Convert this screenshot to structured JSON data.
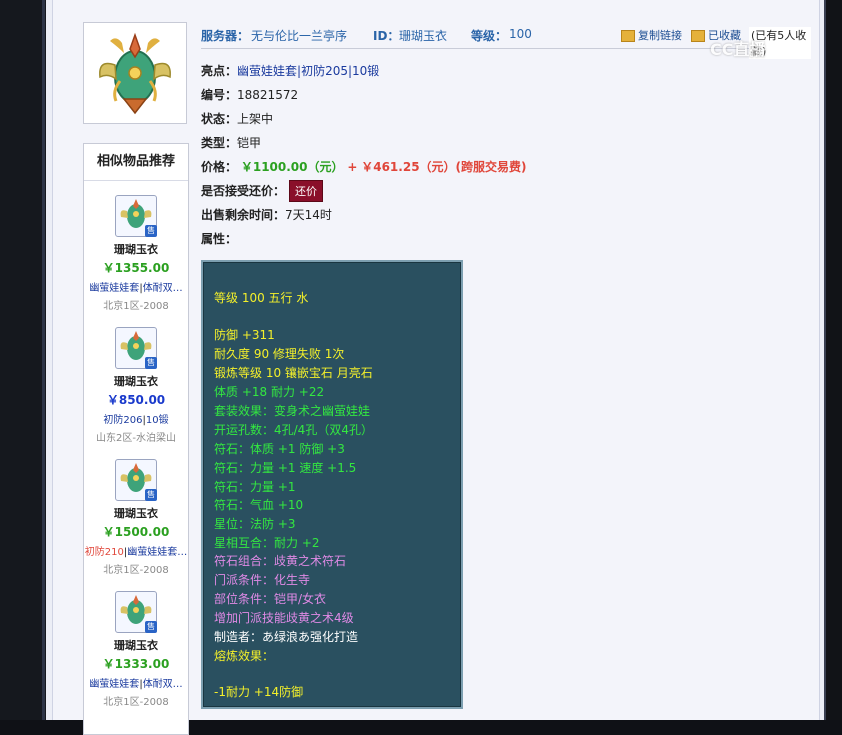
{
  "header": {
    "server_label": "服务器：",
    "server_value": "无与伦比一兰亭序",
    "id_label": "ID：",
    "id_value": "珊瑚玉衣",
    "level_label": "等级：",
    "level_value": "100",
    "copy_link": "复制链接",
    "favorite_link": "已收藏",
    "favorite_count": "(已有5人收藏)"
  },
  "details": {
    "highlight_label": "亮点：",
    "highlight_parts": [
      "幽萤娃娃套",
      "|",
      "初防205",
      "|",
      "10锻"
    ],
    "number_label": "编号：",
    "number_value": "18821572",
    "status_label": "状态：",
    "status_value": "上架中",
    "type_label": "类型：",
    "type_value": "铠甲",
    "price_label": "价格：",
    "price_main": "￥1100.00（元）",
    "price_plus": "+",
    "price_fee": "￥461.25（元）(跨服交易费)",
    "offer_label": "是否接受还价：",
    "offer_button": "还价",
    "remaining_label": "出售剩余时间：",
    "remaining_value": "7天14时",
    "attr_label": "属性："
  },
  "attributes": {
    "lines": [
      {
        "text": "等级 100 五行 水",
        "color": "yellow"
      },
      {
        "text": "防御 +311",
        "color": "yellow"
      },
      {
        "text": "耐久度 90 修理失败 1次",
        "color": "yellow"
      },
      {
        "text": "锻炼等级 10 镶嵌宝石 月亮石",
        "color": "yellow"
      },
      {
        "text": "体质 +18 耐力 +22",
        "color": "green"
      },
      {
        "text": "套装效果：变身术之幽萤娃娃",
        "color": "green"
      },
      {
        "text": "开运孔数：4孔/4孔（双4孔）",
        "color": "green"
      },
      {
        "text": "符石：体质 +1 防御 +3",
        "color": "green"
      },
      {
        "text": "符石：力量 +1 速度 +1.5",
        "color": "green"
      },
      {
        "text": "符石：力量 +1",
        "color": "green"
      },
      {
        "text": "符石：气血 +10",
        "color": "green"
      },
      {
        "text": "星位：法防 +3",
        "color": "green"
      },
      {
        "text": "星相互合：耐力 +2",
        "color": "green"
      },
      {
        "text": "符石组合：歧黄之术符石",
        "color": "purple"
      },
      {
        "text": "门派条件：化生寺",
        "color": "purple"
      },
      {
        "text": "部位条件：铠甲/女衣",
        "color": "purple"
      },
      {
        "text": "增加门派技能歧黄之术4级",
        "color": "purple"
      },
      {
        "text": "制造者：あ绿浪あ强化打造",
        "color": "white"
      },
      {
        "text": "熔炼效果：",
        "color": "yellow"
      },
      {
        "text": "-1耐力 +14防御",
        "color": "yellow"
      }
    ]
  },
  "sidebar": {
    "title": "相似物品推荐",
    "sell_badge": "售",
    "items": [
      {
        "name": "珊瑚玉衣",
        "price": "￥1355.00",
        "price_color": "#2ba020",
        "attr_a": "幽萤娃娃套",
        "attr_sep": "|",
        "attr_b": "体耐双…",
        "attr_a_color": "#1a3a9e",
        "server": "北京1区-2008"
      },
      {
        "name": "珊瑚玉衣",
        "price": "￥850.00",
        "price_color": "#1a3acc",
        "attr_a": "初防206",
        "attr_sep": "|",
        "attr_b": "10锻",
        "attr_a_color": "#1a3a9e",
        "server": "山东2区-水泊梁山"
      },
      {
        "name": "珊瑚玉衣",
        "price": "￥1500.00",
        "price_color": "#2ba020",
        "attr_a": "初防210",
        "attr_sep": "|",
        "attr_b": "幽萤娃娃套…",
        "attr_a_color": "#e0463a",
        "server": "北京1区-2008"
      },
      {
        "name": "珊瑚玉衣",
        "price": "￥1333.00",
        "price_color": "#2ba020",
        "attr_a": "幽萤娃娃套",
        "attr_sep": "|",
        "attr_b": "体耐双…",
        "attr_a_color": "#1a3a9e",
        "server": "北京1区-2008"
      }
    ]
  },
  "watermark": "CC直播",
  "colors": {
    "panel_bg": "#2a5060",
    "yellow": "#f4f02a",
    "green": "#33e840",
    "purple": "#e08ae6",
    "white": "#ffffff",
    "offer_button_bg": "#8a0f2a"
  }
}
